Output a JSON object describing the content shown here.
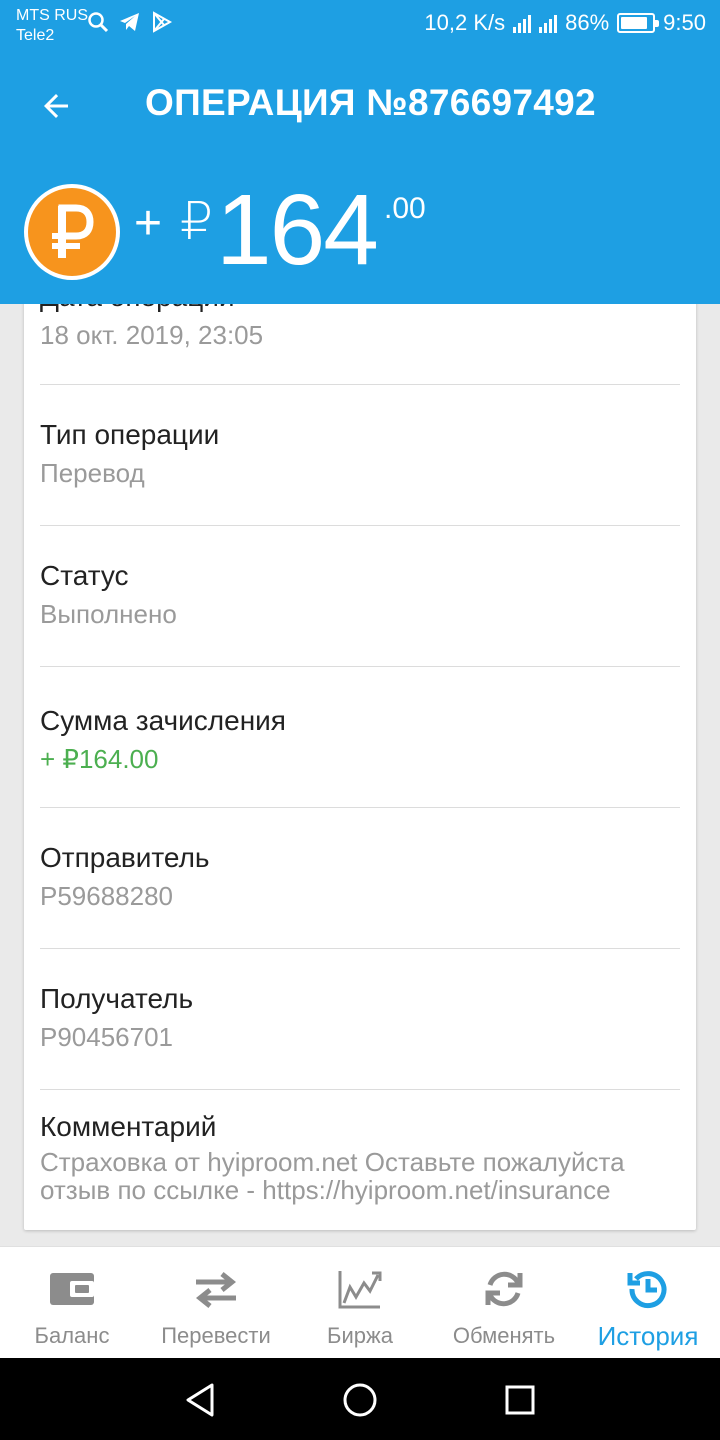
{
  "status_bar": {
    "carrier1": "MTS RUS",
    "carrier2": "Tele2",
    "speed": "10,2 K/s",
    "battery": "86%",
    "battery_level": 0.86,
    "time": "9:50"
  },
  "header": {
    "title": "ОПЕРАЦИЯ №876697492"
  },
  "amount": {
    "sign": "+",
    "currency": "₽",
    "integer": "164",
    "decimal": ".00",
    "coin_color": "#f7941d"
  },
  "details": [
    {
      "label": "Дата операции",
      "value": "18 окт. 2019, 23:05"
    },
    {
      "label": "Тип операции",
      "value": "Перевод"
    },
    {
      "label": "Статус",
      "value": "Выполнено"
    },
    {
      "label": "Сумма зачисления",
      "value": "+ ₽164.00"
    },
    {
      "label": "Отправитель",
      "value": "P59688280"
    },
    {
      "label": "Получатель",
      "value": "P90456701"
    },
    {
      "label": "Комментарий",
      "value_line1": "Страховка от hyiproom.net  Оставьте пожалуйста",
      "value_line2": "отзыв по ссылке - https://hyiproom.net/insurance"
    }
  ],
  "bottom_nav": [
    {
      "label": "Баланс",
      "icon": "wallet-icon"
    },
    {
      "label": "Перевести",
      "icon": "transfer-arrows-icon"
    },
    {
      "label": "Биржа",
      "icon": "chart-icon"
    },
    {
      "label": "Обменять",
      "icon": "exchange-icon"
    },
    {
      "label": "История",
      "icon": "history-icon",
      "active": true
    }
  ],
  "colors": {
    "primary": "#1e9fe3",
    "positive": "#4caf50",
    "muted": "#9a9a9a"
  }
}
